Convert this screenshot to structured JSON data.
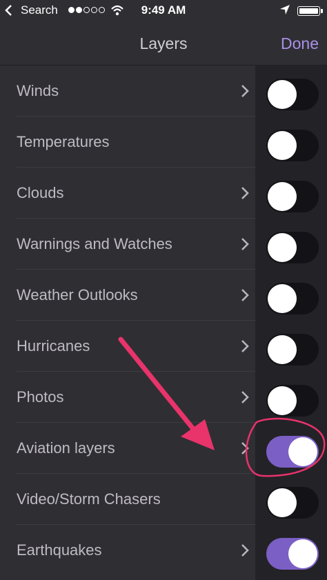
{
  "status_bar": {
    "back_label": "Search",
    "signal_dots": [
      true,
      true,
      false,
      false,
      false
    ],
    "time": "9:49 AM",
    "battery_level": 1.0
  },
  "nav": {
    "title": "Layers",
    "done_label": "Done"
  },
  "layers": [
    {
      "label": "Winds",
      "has_chevron": true,
      "on": false
    },
    {
      "label": "Temperatures",
      "has_chevron": false,
      "on": false
    },
    {
      "label": "Clouds",
      "has_chevron": true,
      "on": false
    },
    {
      "label": "Warnings and Watches",
      "has_chevron": true,
      "on": false
    },
    {
      "label": "Weather Outlooks",
      "has_chevron": true,
      "on": false
    },
    {
      "label": "Hurricanes",
      "has_chevron": true,
      "on": false
    },
    {
      "label": "Photos",
      "has_chevron": true,
      "on": false
    },
    {
      "label": "Aviation layers",
      "has_chevron": true,
      "on": true
    },
    {
      "label": "Video/Storm Chasers",
      "has_chevron": false,
      "on": false
    },
    {
      "label": "Earthquakes",
      "has_chevron": true,
      "on": true
    }
  ],
  "colors": {
    "accent": "#7b5fc4",
    "done": "#a990e6",
    "annotation": "#e8336b"
  },
  "icons": {
    "back": "chevron-left-icon",
    "wifi": "wifi-icon",
    "location": "location-arrow-icon",
    "battery": "battery-icon",
    "row_chevron": "chevron-right-icon"
  }
}
